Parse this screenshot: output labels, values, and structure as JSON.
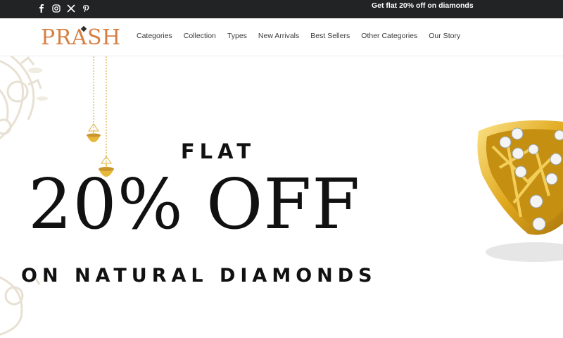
{
  "topbar": {
    "social": [
      {
        "name": "facebook-icon",
        "glyph": "f"
      },
      {
        "name": "instagram-icon",
        "glyph": "ig"
      },
      {
        "name": "x-twitter-icon",
        "glyph": "X"
      },
      {
        "name": "pinterest-icon",
        "glyph": "p"
      }
    ],
    "promo": "Get flat 20% off on diamonds"
  },
  "header": {
    "logo": "PRASH",
    "nav": [
      "Categories",
      "Collection",
      "Types",
      "New Arrivals",
      "Best Sellers",
      "Other Categories",
      "Our Story"
    ]
  },
  "hero": {
    "line1": "FLAT",
    "line2": "20% OFF",
    "line3": "ON NATURAL DIAMONDS"
  },
  "colors": {
    "topbar": "#222325",
    "brand": "#d77f43",
    "gold": "#e5b73b",
    "text": "#111111"
  }
}
